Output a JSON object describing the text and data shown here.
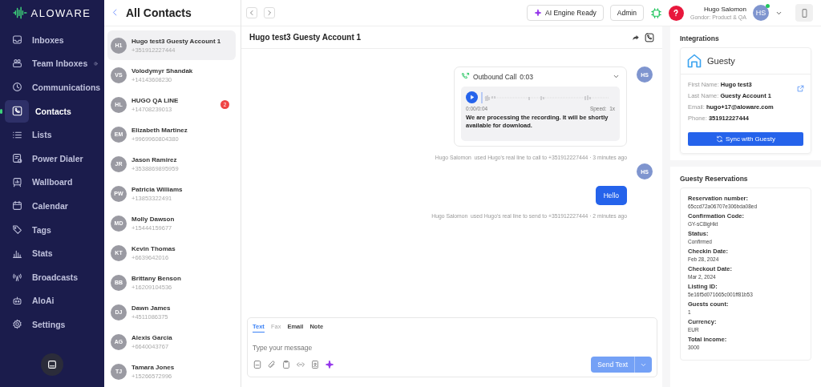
{
  "sidebar": {
    "logo": "ALOWARE",
    "items": [
      {
        "label": "Inboxes",
        "selected": false,
        "info": false
      },
      {
        "label": "Team Inboxes",
        "selected": false,
        "info": true
      },
      {
        "label": "Communications",
        "selected": false,
        "info": false
      },
      {
        "label": "Contacts",
        "selected": true,
        "info": false
      },
      {
        "label": "Lists",
        "selected": false,
        "info": false
      },
      {
        "label": "Power Dialer",
        "selected": false,
        "info": false
      },
      {
        "label": "Wallboard",
        "selected": false,
        "info": false
      },
      {
        "label": "Calendar",
        "selected": false,
        "info": false
      },
      {
        "label": "Tags",
        "selected": false,
        "info": false
      },
      {
        "label": "Stats",
        "selected": false,
        "info": false
      },
      {
        "label": "Broadcasts",
        "selected": false,
        "info": false
      },
      {
        "label": "AloAi",
        "selected": false,
        "info": false
      },
      {
        "label": "Settings",
        "selected": false,
        "info": false
      }
    ]
  },
  "contacts": {
    "title": "All Contacts",
    "items": [
      {
        "initials": "H1",
        "name": "Hugo test3 Guesty Account 1",
        "phone": "+351912227444",
        "selected": true
      },
      {
        "initials": "VS",
        "name": "Volodymyr Shandak",
        "phone": "+14143608230",
        "selected": false
      },
      {
        "initials": "HL",
        "name": "HUGO QA LINE",
        "phone": "+14708239013",
        "selected": false,
        "badge": "2"
      },
      {
        "initials": "EM",
        "name": "Elizabeth Martinez",
        "phone": "+9969960804380",
        "selected": false
      },
      {
        "initials": "JR",
        "name": "Jason Ramirez",
        "phone": "+3538869895959",
        "selected": false
      },
      {
        "initials": "PW",
        "name": "Patricia Williams",
        "phone": "+13853322491",
        "selected": false
      },
      {
        "initials": "MD",
        "name": "Molly Dawson",
        "phone": "+15444159677",
        "selected": false
      },
      {
        "initials": "KT",
        "name": "Kevin Thomas",
        "phone": "+6639642016",
        "selected": false
      },
      {
        "initials": "BB",
        "name": "Brittany Benson",
        "phone": "+16209104536",
        "selected": false
      },
      {
        "initials": "DJ",
        "name": "Dawn James",
        "phone": "+4511086375",
        "selected": false
      },
      {
        "initials": "AG",
        "name": "Alexis Garcia",
        "phone": "+6640043767",
        "selected": false
      },
      {
        "initials": "TJ",
        "name": "Tamara Jones",
        "phone": "+15266572996",
        "selected": false
      }
    ]
  },
  "topbar": {
    "ai_engine": "AI Engine Ready",
    "admin": "Admin",
    "user": {
      "name": "Hugo Salomon",
      "team": "Gondor: Product & QA",
      "initials": "HS",
      "online": true
    }
  },
  "conversation": {
    "title": "Hugo test3 Guesty Account 1",
    "messages": [
      {
        "kind": "call",
        "title": "Outbound Call",
        "duration": "0:03",
        "time": "0:00/0:04",
        "speed_label": "Speed:",
        "speed": "1x",
        "note": "We are processing the recording. It will be shortly available for download.",
        "avatar": "HS",
        "author": "Hugo Salomon",
        "meta": "used Hugo's real line to call to +351912227444 · 3 minutes ago"
      },
      {
        "kind": "text",
        "text": "Hello",
        "avatar": "HS",
        "author": "Hugo Salomon",
        "meta": "used Hugo's real line to send to +351912227444 · 2 minutes ago"
      }
    ]
  },
  "composer": {
    "tabs": [
      {
        "label": "Text",
        "selected": true,
        "disabled": false
      },
      {
        "label": "Fax",
        "selected": false,
        "disabled": true
      },
      {
        "label": "Email",
        "selected": false,
        "disabled": false
      },
      {
        "label": "Note",
        "selected": false,
        "disabled": false
      }
    ],
    "placeholder": "Type your message",
    "send": "Send Text"
  },
  "integrations": {
    "title": "Integrations",
    "provider": "Guesty",
    "fields": [
      {
        "label": "First Name:",
        "value": "Hugo test3"
      },
      {
        "label": "Last Name:",
        "value": "Guesty Account 1"
      },
      {
        "label": "Email:",
        "value": "hugo+17@aloware.com"
      },
      {
        "label": "Phone:",
        "value": "351912227444"
      }
    ],
    "sync": "Sync with Guesty"
  },
  "reservations": {
    "title": "Guesty Reservations",
    "fields": [
      {
        "label": "Reservation number:",
        "value": "65ccd72a06707e306bda08ed"
      },
      {
        "label": "Confirmation Code:",
        "value": "GY-sC8igHkt"
      },
      {
        "label": "Status:",
        "value": "Confirmed"
      },
      {
        "label": "Checkin Date:",
        "value": "Feb 28, 2024"
      },
      {
        "label": "Checkout Date:",
        "value": "Mar 2, 2024"
      },
      {
        "label": "Listing ID:",
        "value": "5e16f5d071665c001ff81b53"
      },
      {
        "label": "Guests count:",
        "value": "1"
      },
      {
        "label": "Currency:",
        "value": "EUR"
      },
      {
        "label": "Total income:",
        "value": "3000"
      }
    ]
  }
}
